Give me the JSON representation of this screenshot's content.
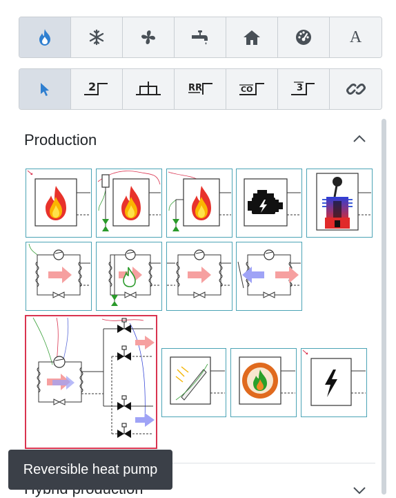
{
  "toolbar_top": {
    "items": [
      {
        "name": "flame-icon",
        "active": true
      },
      {
        "name": "snowflake-icon",
        "active": false
      },
      {
        "name": "fan-icon",
        "active": false
      },
      {
        "name": "faucet-icon",
        "active": false
      },
      {
        "name": "home-icon",
        "active": false
      },
      {
        "name": "gauge-icon",
        "active": false
      },
      {
        "name": "text-icon",
        "label": "A",
        "active": false
      }
    ]
  },
  "toolbar_bottom": {
    "items": [
      {
        "name": "cursor-icon",
        "active": true
      },
      {
        "name": "level-2-icon",
        "label": "2"
      },
      {
        "name": "connector-icon"
      },
      {
        "name": "rr-icon",
        "label": "RR"
      },
      {
        "name": "co-icon",
        "label": "CO"
      },
      {
        "name": "level-3-icon",
        "label": "3"
      },
      {
        "name": "link-icon"
      }
    ]
  },
  "sections": {
    "production": {
      "title": "Production",
      "expanded": true
    },
    "hybrid": {
      "title": "Hybrid production",
      "expanded": false
    }
  },
  "tiles": [
    {
      "name": "boiler-tile"
    },
    {
      "name": "boiler-with-tank-tile"
    },
    {
      "name": "boiler-with-pump-tile"
    },
    {
      "name": "engine-chp-tile"
    },
    {
      "name": "stirling-engine-tile"
    },
    {
      "name": "heat-pump-tile"
    },
    {
      "name": "gas-heat-pump-tile"
    },
    {
      "name": "heat-pump-variant-tile"
    },
    {
      "name": "heat-pump-exchange-tile"
    },
    {
      "name": "reversible-heat-pump-tile",
      "selected": true
    },
    {
      "name": "solar-thermal-tile"
    },
    {
      "name": "biomass-boiler-tile"
    },
    {
      "name": "electric-boiler-tile"
    }
  ],
  "tooltip": {
    "text": "Reversible heat pump"
  },
  "colors": {
    "accent": "#2f7fd0",
    "tile_border": "#4aa3b5",
    "selected_border": "#d9334f",
    "tooltip_bg": "#3b4048"
  }
}
